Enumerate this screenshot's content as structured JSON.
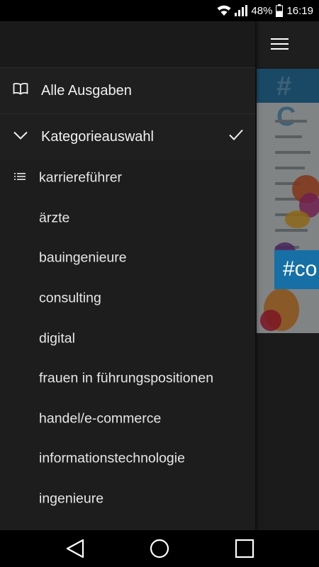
{
  "status_bar": {
    "battery_percent": "48%",
    "time": "16:19",
    "icons": [
      "wifi-icon",
      "signal-icon",
      "battery-icon"
    ]
  },
  "app_bar": {
    "menu_icon": "hamburger-menu-icon"
  },
  "drawer": {
    "all_editions": {
      "label": "Alle Ausgaben",
      "icon": "book-icon"
    },
    "category_selection": {
      "label": "Kategorieauswahl",
      "icon": "chevron-down-icon",
      "selected_icon": "checkmark-icon"
    },
    "categories": [
      {
        "label": "karriereführer",
        "icon": "list-icon"
      },
      {
        "label": "ärzte"
      },
      {
        "label": "bauingenieure"
      },
      {
        "label": "consulting"
      },
      {
        "label": "digital"
      },
      {
        "label": "frauen in führungspositionen"
      },
      {
        "label": "handel/e-commerce"
      },
      {
        "label": "informationstechnologie"
      },
      {
        "label": "ingenieure"
      }
    ]
  },
  "content_preview": {
    "hashtag_text": "#co",
    "band_text": "# C"
  },
  "nav_bar": {
    "back": "back-triangle-icon",
    "home": "home-circle-icon",
    "recents": "recents-square-icon"
  },
  "colors": {
    "drawer_bg": "#1d1d1d",
    "accent_blue": "#1670a6",
    "text": "#ececec"
  }
}
